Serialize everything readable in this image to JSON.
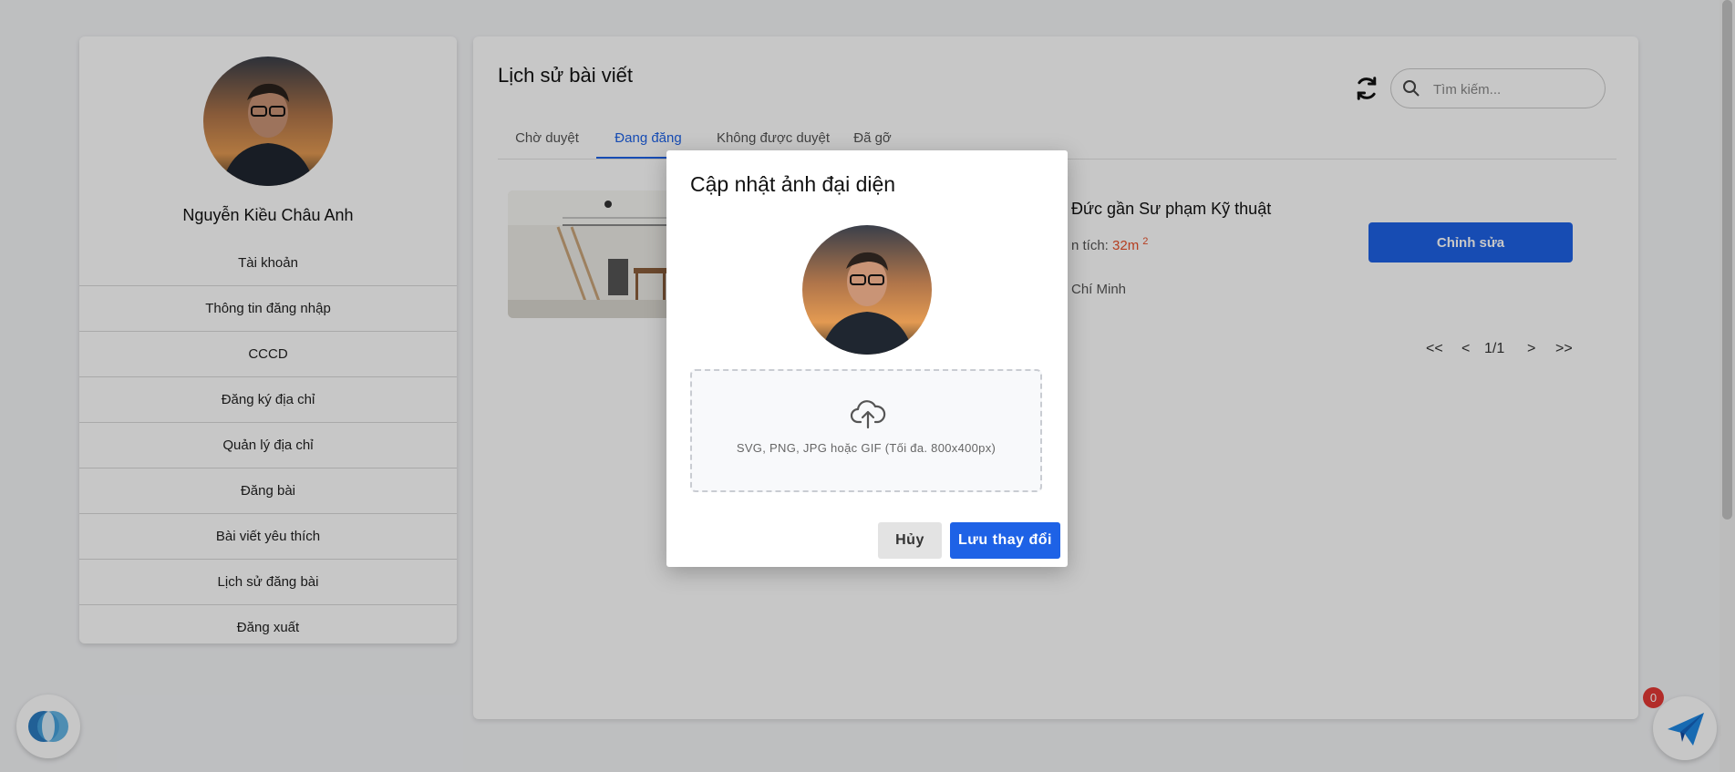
{
  "sidebar": {
    "user_name": "Nguyễn Kiều Châu Anh",
    "items": [
      {
        "label": "Tài khoản"
      },
      {
        "label": "Thông tin đăng nhập"
      },
      {
        "label": "CCCD"
      },
      {
        "label": "Đăng ký địa chỉ"
      },
      {
        "label": "Quản lý địa chỉ"
      },
      {
        "label": "Đăng bài"
      },
      {
        "label": "Bài viết yêu thích"
      },
      {
        "label": "Lịch sử đăng bài"
      },
      {
        "label": "Đăng xuất"
      }
    ]
  },
  "main": {
    "title": "Lịch sử bài viết",
    "search_placeholder": "Tìm kiếm...",
    "tabs": [
      {
        "label": "Chờ duyệt",
        "active": false
      },
      {
        "label": "Đang đăng",
        "active": true
      },
      {
        "label": "Không được duyệt",
        "active": false
      },
      {
        "label": "Đã gỡ",
        "active": false
      }
    ],
    "post": {
      "title_visible": "Đức gần Sư phạm Kỹ thuật",
      "area_label_visible": "n tích:",
      "area_value": "32m",
      "area_sup": "2",
      "city_visible": "Chí Minh"
    },
    "edit_label": "Chỉnh sửa",
    "pagination": {
      "first": "<<",
      "prev": "<",
      "page": "1/1",
      "next": ">",
      "last": ">>"
    }
  },
  "notifications": {
    "badge_count": "0"
  },
  "modal": {
    "title": "Cập nhật ảnh đại diện",
    "dropzone_hint": "SVG, PNG, JPG hoặc GIF (Tối đa. 800x400px)",
    "cancel_label": "Hủy",
    "save_label": "Lưu thay đổi"
  },
  "colors": {
    "primary": "#1e62e6",
    "accent_orange": "#e8502a",
    "badge_red": "#e53935"
  },
  "icons": [
    "refresh-icon",
    "search-icon",
    "upload-cloud-icon",
    "send-icon",
    "chat-bubble-icon"
  ]
}
